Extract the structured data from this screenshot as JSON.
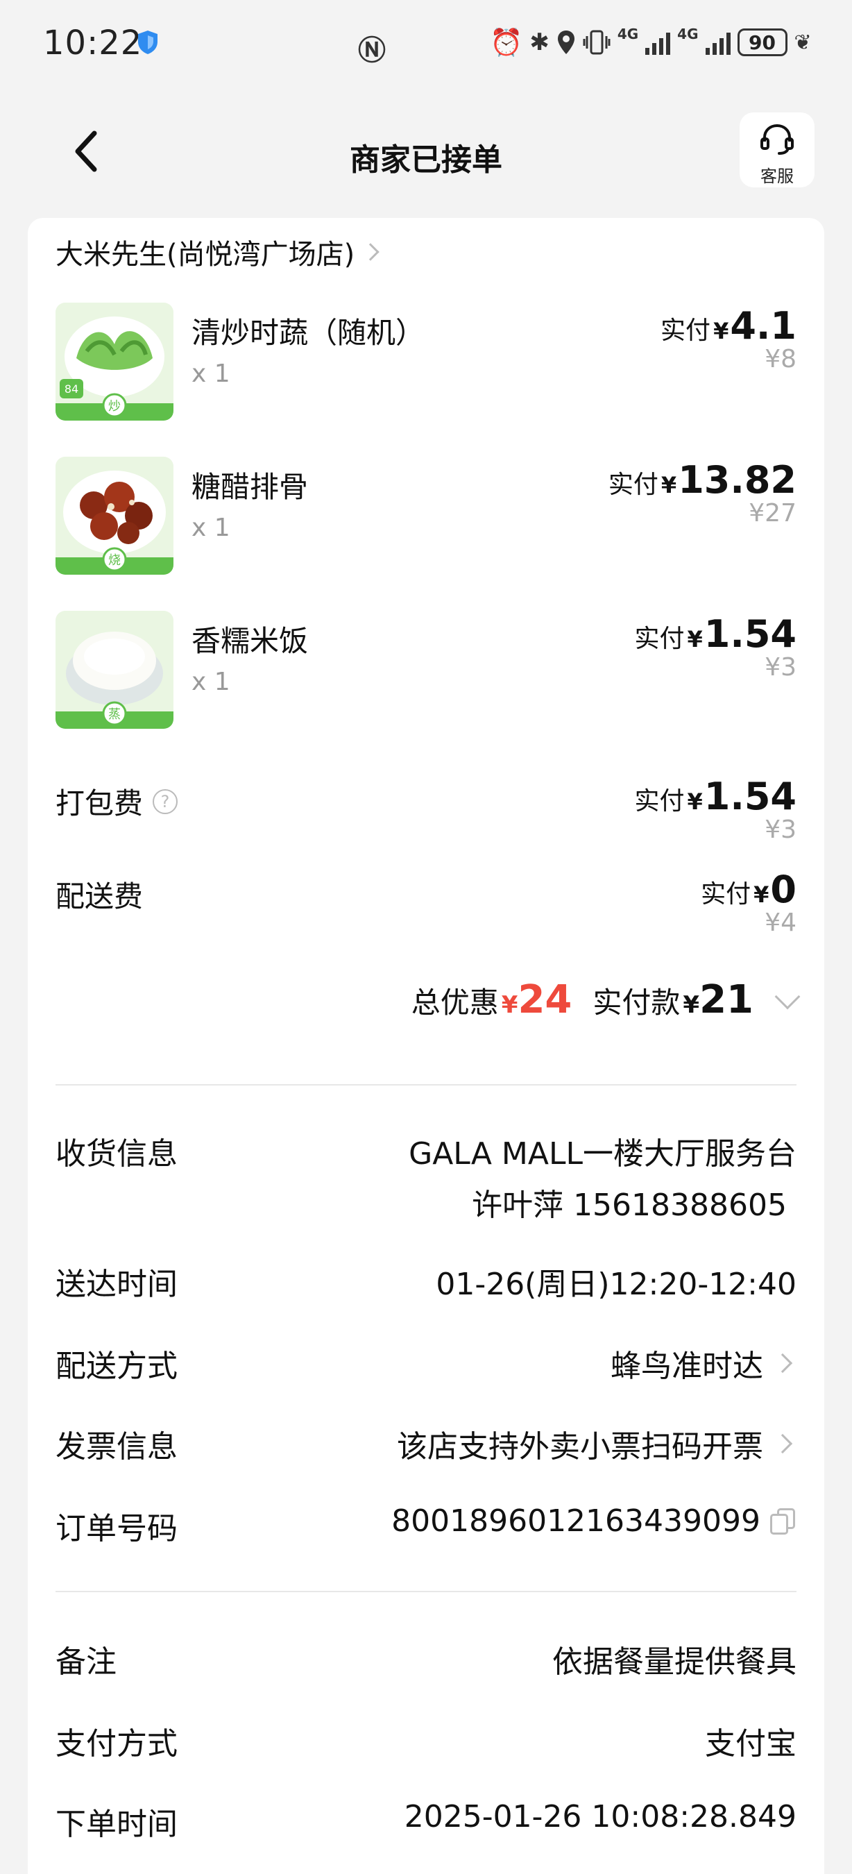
{
  "status_bar": {
    "time": "10:22",
    "network_1": "4G",
    "network_2": "4G",
    "battery": "90",
    "icons": [
      "shield-icon",
      "nfc-icon",
      "alarm-icon",
      "bluetooth-icon",
      "location-icon",
      "vibrate-icon",
      "signal-icon",
      "battery-icon",
      "leaf-icon"
    ]
  },
  "header": {
    "title": "商家已接单",
    "customer_service_label": "客服"
  },
  "store": {
    "name": "大米先生(尚悦湾广场店)"
  },
  "items": [
    {
      "name": "清炒时蔬（随机）",
      "qty": "x 1",
      "paid_label": "实付",
      "currency": "¥",
      "paid": "4.1",
      "original": "¥8",
      "thumb_badge": "84"
    },
    {
      "name": "糖醋排骨",
      "qty": "x 1",
      "paid_label": "实付",
      "currency": "¥",
      "paid": "13.82",
      "original": "¥27"
    },
    {
      "name": "香糯米饭",
      "qty": "x 1",
      "paid_label": "实付",
      "currency": "¥",
      "paid": "1.54",
      "original": "¥3"
    }
  ],
  "fees": {
    "packaging": {
      "label": "打包费",
      "help": "?",
      "paid_label": "实付",
      "currency": "¥",
      "paid": "1.54",
      "original": "¥3"
    },
    "delivery": {
      "label": "配送费",
      "paid_label": "实付",
      "currency": "¥",
      "paid": "0",
      "original": "¥4"
    }
  },
  "totals": {
    "discount_label": "总优惠",
    "discount_currency": "¥",
    "discount": "24",
    "paid_label": "实付款",
    "paid_currency": "¥",
    "paid": "21"
  },
  "order_info": {
    "receiver_label": "收货信息",
    "receiver_address": "GALA MALL一楼大厅服务台",
    "receiver_contact": "许叶萍 15618388605",
    "delivery_time_label": "送达时间",
    "delivery_time": "01-26(周日)12:20-12:40",
    "delivery_method_label": "配送方式",
    "delivery_method": "蜂鸟准时达",
    "invoice_label": "发票信息",
    "invoice": "该店支持外卖小票扫码开票",
    "order_no_label": "订单号码",
    "order_no": "8001896012163439099"
  },
  "extra_info": {
    "note_label": "备注",
    "note": "依据餐量提供餐具",
    "payment_label": "支付方式",
    "payment": "支付宝",
    "order_time_label": "下单时间",
    "order_time": "2025-01-26 10:08:28.849"
  },
  "colors": {
    "page_bg": "#f3f3f3",
    "card_bg": "#ffffff",
    "discount_red": "#ee4a3c",
    "muted_gray": "#aaaaaa",
    "thumb_green": "#5fbf4a"
  }
}
